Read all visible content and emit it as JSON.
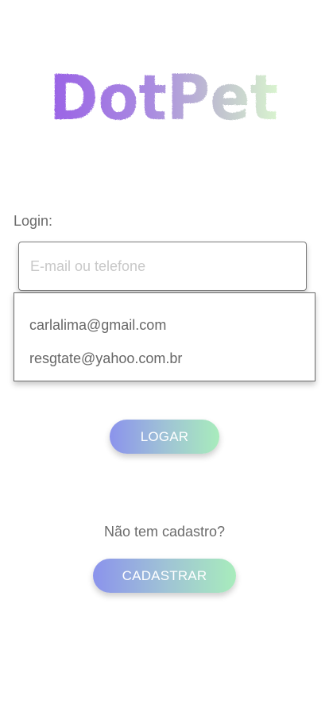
{
  "app": {
    "logo_text": "DotPet"
  },
  "login": {
    "label": "Login:",
    "placeholder": "E-mail ou telefone",
    "value": ""
  },
  "suggestions": [
    {
      "email": "carlalima@gmail.com"
    },
    {
      "email": "resgtate@yahoo.com.br"
    }
  ],
  "buttons": {
    "login_label": "LOGAR",
    "register_label": "CADASTRAR"
  },
  "signup": {
    "prompt": "Não tem cadastro?"
  },
  "colors": {
    "logo_start": "#9a63e6",
    "logo_end": "#cff5cf",
    "button_start": "#8b93ec",
    "button_end": "#a8ecbc"
  }
}
